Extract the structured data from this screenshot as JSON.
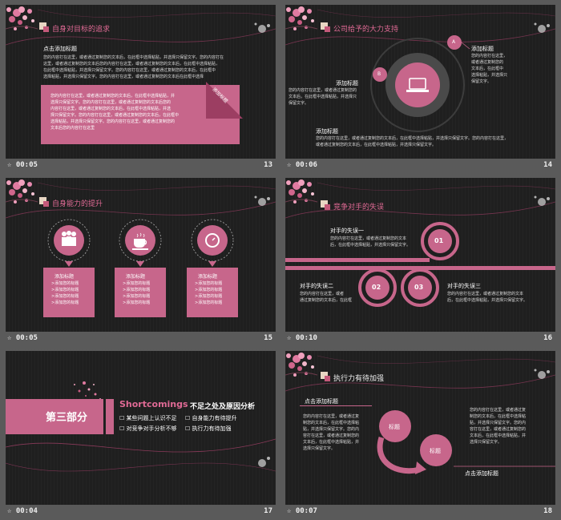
{
  "colors": {
    "accent": "#c7668b",
    "background": "#1f1f1f",
    "frame": "#5a5a5a"
  },
  "slides": [
    {
      "time": "00:05",
      "number": "13",
      "title": "自身对目标的追求",
      "subtitle": "点击添加标题",
      "lines": [
        "您的内容打在这里，或者通过复制您的文本后，在此框中选择粘贴，并选择只保留文字。您的内容打在",
        "这里，或者通过复制您的文本后您的内容打在这里，或者通过复制您的文本后，在此框中选择粘贴，",
        "在此框中选择粘贴，并选择只保留文字。您的内容打在这里，或者通过复制您的文本后，在此框中",
        "选择粘贴，并选择只保留文字。您的内容打在这里，或者通过复制您的文本后在此框中选择"
      ],
      "box_lines": [
        "您的内容打在这里，或者通过复制您的文本后，在此框中选择粘贴，并",
        "选择只保留文字。您的内容打在这里，或者通过复制您的文本后您的",
        "内容打在这里，或者通过复制您的文本后，在此框中选择粘贴，并选",
        "择只保留文字。您的内容打在这里，或者通过复制您的文本后，在此框中",
        "选择粘贴，并选择只保留文字。您的内容打在这里，或者通过复制您的",
        "文本后您的内容打在这里"
      ],
      "tag": "添加标题"
    },
    {
      "time": "00:06",
      "number": "14",
      "title": "公司给予的大力支持",
      "label_a": "A",
      "label_b": "B",
      "b_head": "添加标题",
      "b_lines": [
        "您的内容打在这里，或者通过复制您的",
        "文本后，在此框中选择粘贴，并选择只",
        "保留文字。"
      ],
      "a_head": "添加标题",
      "a_lines": [
        "您的内容打在这里，",
        "或者通过复制您的",
        "文本后，在此框中",
        "选择粘贴，并选择只",
        "保留文字。"
      ],
      "c_head": "添加标题",
      "c_lines": [
        "您的内容打在这里，或者通过复制您的文本后，在此框中选择粘贴，并选择只保留文字。您的内容打在这里，",
        "或者通过复制您的文本后，在此框中选择粘贴，并选择只保留文字。"
      ]
    },
    {
      "time": "00:05",
      "number": "15",
      "title": "自身能力的提升",
      "icons": [
        "people-icon",
        "coffee-icon",
        "clock-icon"
      ],
      "cards": [
        {
          "head": "添加标题",
          "items": [
            ">添加您的标题",
            ">添加您的标题",
            ">添加您的标题",
            ">添加您的标题"
          ]
        },
        {
          "head": "添加标题",
          "items": [
            ">添加您的标题",
            ">添加您的标题",
            ">添加您的标题",
            ">添加您的标题"
          ]
        },
        {
          "head": "添加标题",
          "items": [
            ">添加您的标题",
            ">添加您的标题",
            ">添加您的标题",
            ">添加您的标题"
          ]
        }
      ]
    },
    {
      "time": "00:10",
      "number": "16",
      "title": "竞争对手的失误",
      "c1": "01",
      "c2": "02",
      "c3": "03",
      "m1_head": "对手的失误一",
      "m1_lines": [
        "您的内容打在这里，或者通过复制您的文本",
        "后，在此框中选择粘贴，并选择只保留文字。"
      ],
      "m2_head": "对手的失误二",
      "m2_lines": [
        "您的内容打在这里，或者",
        "通过复制您的文本后，在此框"
      ],
      "m3_head": "对手的失误三",
      "m3_lines": [
        "您的内容打在这里，或者通过复制您的文本",
        "后，在此框中选择粘贴，并选择只保留文字。"
      ]
    },
    {
      "time": "00:04",
      "number": "17",
      "part": "第三部分",
      "en": "Shortcomings",
      "cn": "不足之处及原因分析",
      "items": [
        "某些问题上认识不足",
        "自身能力有待提升",
        "对竞争对手分析不够",
        "执行力有待加强"
      ]
    },
    {
      "time": "00:07",
      "number": "18",
      "title": "执行力有待加强",
      "head": "点击添加标题",
      "left_lines": [
        "您的内容打在这里，或者通过复",
        "制您的文本后，在此框中选择粘",
        "贴，并选择只保留文字。您的内",
        "容打在这里，或者通过复制您的",
        "文本后，在此框中选择粘贴，并",
        "选择只保留文字。"
      ],
      "right_lines": [
        "您的内容打在这里，或者通过复",
        "制您的文本后，在此框中选择粘",
        "贴，并选择只保留文字。您的内",
        "容打在这里，或者通过复制您的",
        "文本后，在此框中选择粘贴，并",
        "选择只保留文字。"
      ],
      "bubble1": "标题",
      "bubble2": "标题",
      "bottom_head": "点击添加标题"
    }
  ]
}
